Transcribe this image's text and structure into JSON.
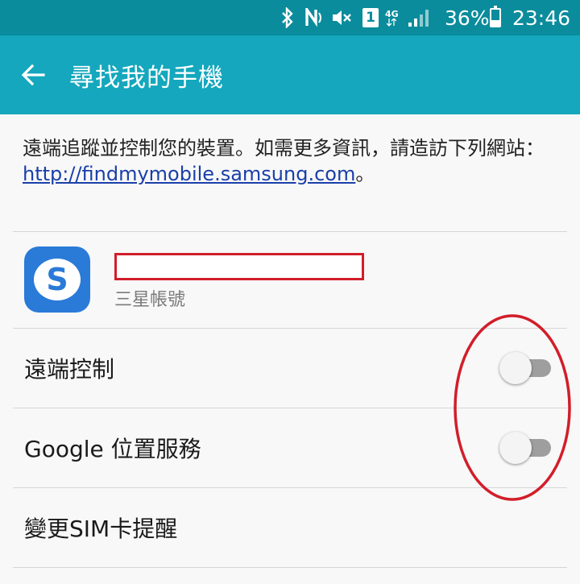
{
  "status_bar": {
    "battery_percent": "36%",
    "time": "23:46",
    "sim_label": "1",
    "network": "4G",
    "bluetooth_icon": "bluetooth-icon",
    "nfc_icon": "nfc-icon",
    "mute_icon": "mute-icon",
    "signal_icon": "signal-icon",
    "battery_level": 0.36
  },
  "app_bar": {
    "title": "尋找我的手機",
    "back_icon": "back-arrow-icon",
    "color": "#14a7bd"
  },
  "description": {
    "text": "遠端追蹤並控制您的裝置。如需更多資訊，請造訪下列網站：",
    "link": "http://findmymobile.samsung.com",
    "suffix": "。"
  },
  "account": {
    "app_icon_letter": "S",
    "subtitle": "三星帳號"
  },
  "settings": [
    {
      "label": "遠端控制",
      "toggle": false
    },
    {
      "label": "Google 位置服務",
      "toggle": false
    },
    {
      "label": "變更SIM卡提醒"
    }
  ],
  "colors": {
    "status_bar": "#0a8c9c",
    "annotation": "#d21e2a",
    "link": "#1a3fa8"
  }
}
